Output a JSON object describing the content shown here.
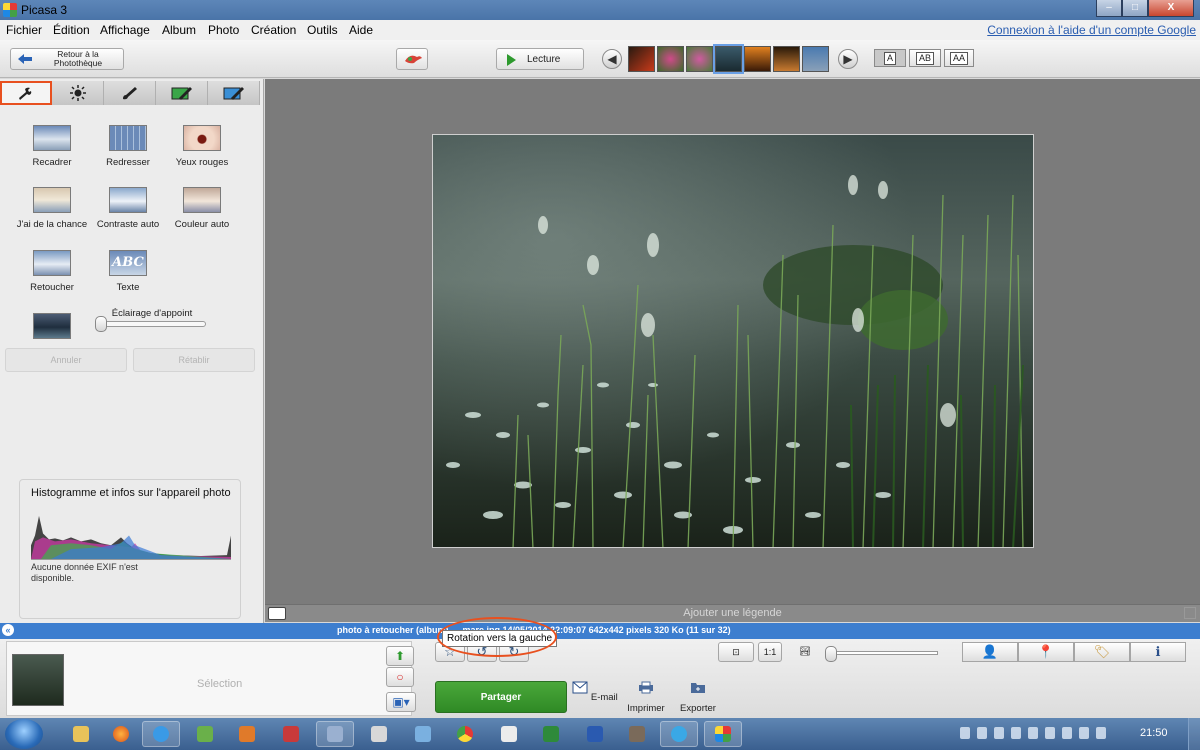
{
  "window": {
    "title": "Picasa 3",
    "controls": [
      "–",
      "□",
      "X"
    ]
  },
  "menu": {
    "items": [
      "Fichier",
      "Édition",
      "Affichage",
      "Album",
      "Photo",
      "Création",
      "Outils",
      "Aide"
    ],
    "help_link": "Connexion à l'aide d'un compte Google"
  },
  "toolbar": {
    "back_label": "Retour à la Photothèque",
    "play_label": "Lecture",
    "caption_modes": [
      "A",
      "AB",
      "AA"
    ]
  },
  "tools": {
    "crop": "Recadrer",
    "straighten": "Redresser",
    "redeye": "Yeux rouges",
    "feeling_lucky": "J'ai de la chance",
    "auto_contrast": "Contraste auto",
    "auto_color": "Couleur auto",
    "retouch": "Retoucher",
    "text": "Texte",
    "text_icon_label": "ABC",
    "fill_light": "Éclairage d'appoint",
    "fill_light_level": 0,
    "undo": "Annuler",
    "redo": "Rétablir"
  },
  "histogram": {
    "title": "Histogramme et infos sur l'appareil photo",
    "note": "Aucune donnée EXIF n'est disponible."
  },
  "viewer": {
    "caption_placeholder": "Ajouter une légende"
  },
  "status": {
    "text": "photo à retoucher (album) … mare.jpg   14/05/2014 22:09:07   642x442 pixels   320 Ko   (11 sur 32)"
  },
  "tray": {
    "selection_label": "Sélection",
    "tooltip": "Rotation vers la gauche",
    "zoom_fit": "⊡",
    "zoom_1to1": "1:1",
    "share": "Partager",
    "email": "E-mail",
    "print": "Imprimer",
    "export": "Exporter"
  },
  "taskbar": {
    "time": "21:50"
  },
  "colors": {
    "accent": "#e8501f",
    "status_bar": "#3d7ecf",
    "share": "#3a9a2e"
  }
}
